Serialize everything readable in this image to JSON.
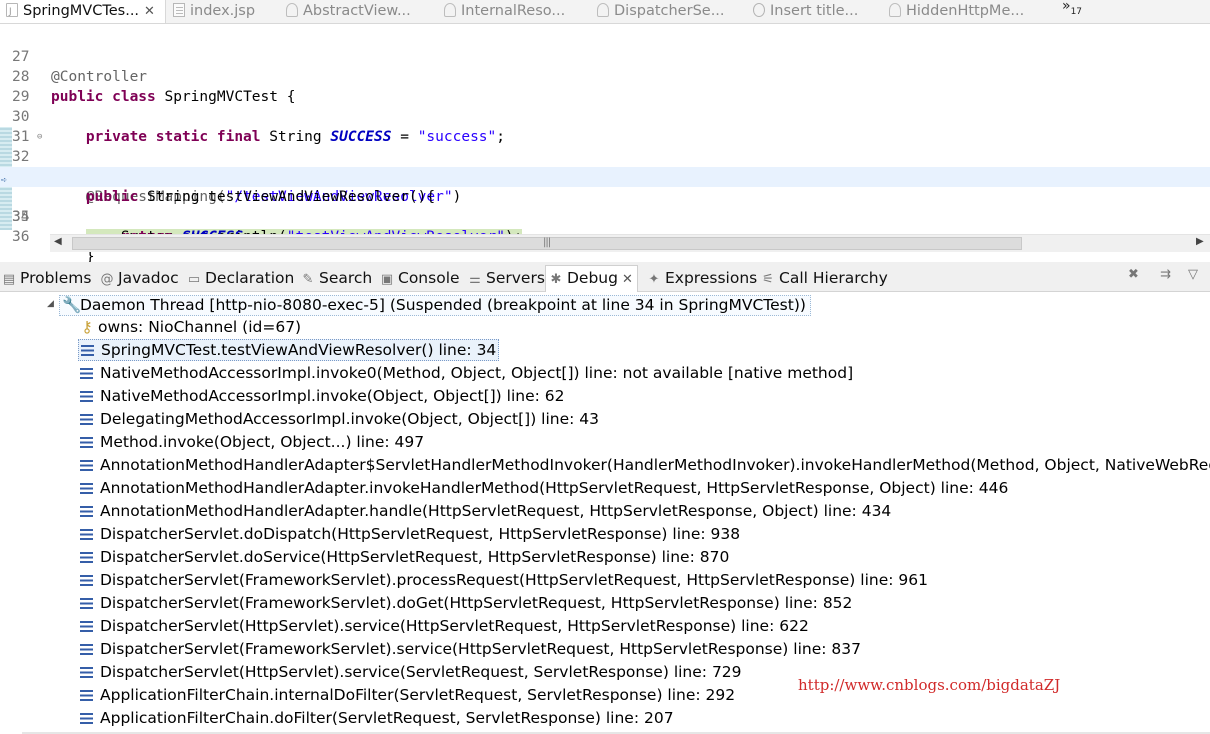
{
  "editor_tabs": [
    {
      "label": "SpringMVCTes...",
      "icon": "java-file-icon",
      "active": true
    },
    {
      "label": "index.jsp",
      "icon": "jsp-file-icon"
    },
    {
      "label": "AbstractView...",
      "icon": "class-file-icon"
    },
    {
      "label": "InternalReso...",
      "icon": "class-file-icon"
    },
    {
      "label": "DispatcherSe...",
      "icon": "class-file-icon"
    },
    {
      "label": "Insert title...",
      "icon": "web-browser-icon"
    },
    {
      "label": "HiddenHttpMe...",
      "icon": "class-file-icon"
    }
  ],
  "tab_overflow": {
    "chevron": "»",
    "count": "17"
  },
  "code_lines": [
    {
      "n": "27",
      "text": "@Controller"
    },
    {
      "n": "28",
      "text": "public class SpringMVCTest {"
    },
    {
      "n": "29",
      "text": ""
    },
    {
      "n": "30",
      "text": "    private static final String SUCCESS = \"success\";"
    },
    {
      "n": "31",
      "text": ""
    },
    {
      "n": "32",
      "text": "    @RequestMapping(\"/testViewAndViewResolver\")"
    },
    {
      "n": "33",
      "text": "    public String testViewAndViewResolver(){"
    },
    {
      "n": "34",
      "text": "        System.out.println(\"testViewAndViewResolver\");"
    },
    {
      "n": "35",
      "text": "        return SUCCESS;"
    },
    {
      "n": "36",
      "text": "    }"
    }
  ],
  "code_tokens": {
    "l27": "@Controller",
    "l28_kw": "public class",
    "l28_rest": " SpringMVCTest {",
    "l30_kw": "private static final",
    "l30_type": " String ",
    "l30_fld": "SUCCESS",
    "l30_eq": " = ",
    "l30_str": "\"success\"",
    "l30_end": ";",
    "l32_ann": "@RequestMapping(",
    "l32_str": "\"/testViewAndViewResolver\"",
    "l32_end": ")",
    "l33_kw": "public",
    "l33_rest": " String testViewAndViewResolver(){",
    "l34_a": "System.",
    "l34_fld": "out",
    "l34_b": ".println(",
    "l34_str": "\"testViewAndViewResolver\"",
    "l34_end": ");",
    "l35_kw": "return",
    "l35_fld": "SUCCESS",
    "l35_end": ";",
    "l36": "}"
  },
  "view_tabs": [
    {
      "label": "Problems",
      "icon": "problems-icon"
    },
    {
      "label": "Javadoc",
      "icon": "javadoc-icon"
    },
    {
      "label": "Declaration",
      "icon": "declaration-icon"
    },
    {
      "label": "Search",
      "icon": "search-icon"
    },
    {
      "label": "Console",
      "icon": "console-icon"
    },
    {
      "label": "Servers",
      "icon": "servers-icon"
    },
    {
      "label": "Debug",
      "icon": "debug-icon",
      "active": true
    },
    {
      "label": "Expressions",
      "icon": "expressions-icon"
    },
    {
      "label": "Call Hierarchy",
      "icon": "call-hierarchy-icon"
    }
  ],
  "debug": {
    "thread": "Daemon Thread [http-nio-8080-exec-5] (Suspended (breakpoint at line 34 in SpringMVCTest))",
    "owns": "owns: NioChannel  (id=67)",
    "frames": [
      "SpringMVCTest.testViewAndViewResolver() line: 34",
      "NativeMethodAccessorImpl.invoke0(Method, Object, Object[]) line: not available [native method]",
      "NativeMethodAccessorImpl.invoke(Object, Object[]) line: 62",
      "DelegatingMethodAccessorImpl.invoke(Object, Object[]) line: 43",
      "Method.invoke(Object, Object...) line: 497",
      "AnnotationMethodHandlerAdapter$ServletHandlerMethodInvoker(HandlerMethodInvoker).invokeHandlerMethod(Method, Object, NativeWebRequest",
      "AnnotationMethodHandlerAdapter.invokeHandlerMethod(HttpServletRequest, HttpServletResponse, Object) line: 446",
      "AnnotationMethodHandlerAdapter.handle(HttpServletRequest, HttpServletResponse, Object) line: 434",
      "DispatcherServlet.doDispatch(HttpServletRequest, HttpServletResponse) line: 938",
      "DispatcherServlet.doService(HttpServletRequest, HttpServletResponse) line: 870",
      "DispatcherServlet(FrameworkServlet).processRequest(HttpServletRequest, HttpServletResponse) line: 961",
      "DispatcherServlet(FrameworkServlet).doGet(HttpServletRequest, HttpServletResponse) line: 852",
      "DispatcherServlet(HttpServlet).service(HttpServletRequest, HttpServletResponse) line: 622",
      "DispatcherServlet(FrameworkServlet).service(HttpServletRequest, HttpServletResponse) line: 837",
      "DispatcherServlet(HttpServlet).service(ServletRequest, ServletResponse) line: 729",
      "ApplicationFilterChain.internalDoFilter(ServletRequest, ServletResponse) line: 292",
      "ApplicationFilterChain.doFilter(ServletRequest, ServletResponse) line: 207"
    ]
  },
  "watermark": "http://www.cnblogs.com/bigdataZJ",
  "colors": {
    "keyword": "#7f0055",
    "string": "#2a00ff",
    "field": "#0000c0",
    "current_line": "#e8f2fe",
    "highlight": "#d4e8bd",
    "watermark": "#d12a2a"
  }
}
